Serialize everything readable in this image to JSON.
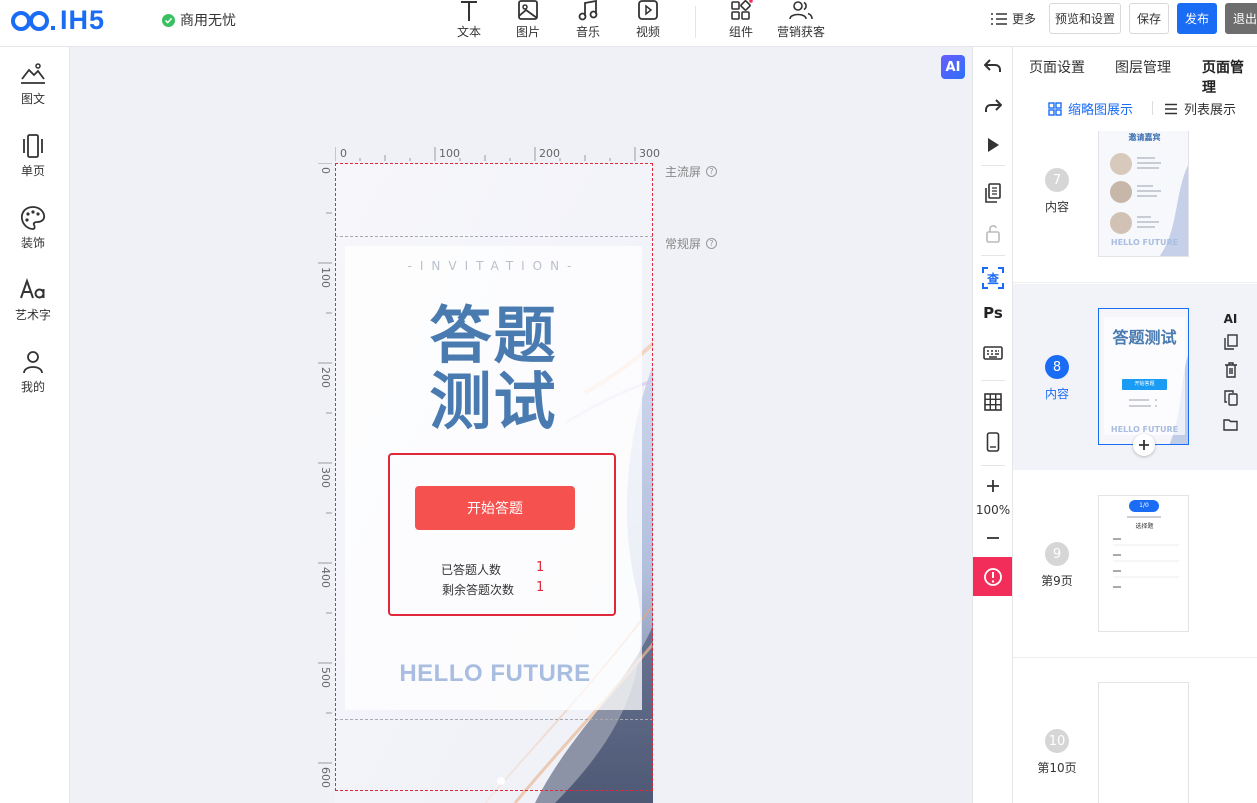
{
  "header": {
    "logo_text": "IH5",
    "commercial_label": "商用无忧",
    "tools": [
      {
        "label": "文本",
        "icon": "text-icon"
      },
      {
        "label": "图片",
        "icon": "image-icon"
      },
      {
        "label": "音乐",
        "icon": "music-icon"
      },
      {
        "label": "视频",
        "icon": "video-icon"
      },
      {
        "label": "组件",
        "icon": "component-icon"
      },
      {
        "label": "营销获客",
        "icon": "marketing-icon"
      }
    ],
    "more_label": "更多",
    "preview_label": "预览和设置",
    "save_label": "保存",
    "publish_label": "发布",
    "exit_label": "退出"
  },
  "sidebar": {
    "items": [
      {
        "label": "图文",
        "icon": "graphic-text-icon"
      },
      {
        "label": "单页",
        "icon": "single-page-icon"
      },
      {
        "label": "装饰",
        "icon": "palette-icon"
      },
      {
        "label": "艺术字",
        "icon": "art-text-icon"
      },
      {
        "label": "我的",
        "icon": "user-icon"
      }
    ]
  },
  "canvas": {
    "ai_label": "AI",
    "ruler_top": [
      "0",
      "100",
      "200",
      "300"
    ],
    "ruler_left": [
      "0",
      "100",
      "200",
      "300",
      "400",
      "500",
      "600"
    ],
    "main_screen_label": "主流屏",
    "normal_screen_label": "常规屏",
    "invitation_text": "-INVITATION-",
    "title_line1": "答题",
    "title_line2": "测试",
    "start_button": "开始答题",
    "answered_label": "已答题人数",
    "answered_value": "1",
    "remaining_label": "剩余答题次数",
    "remaining_value": "1",
    "hello_text": "HELLO FUTURE"
  },
  "vertical_toolbar": {
    "zoom_level": "100%",
    "ps_label": "Ps",
    "check_label": "查"
  },
  "right_panel": {
    "tabs": [
      "页面设置",
      "图层管理",
      "页面管理"
    ],
    "view_thumbnail": "缩略图展示",
    "view_list": "列表展示",
    "pages": [
      {
        "num": "7",
        "label": "内容"
      },
      {
        "num": "8",
        "label": "内容"
      },
      {
        "num": "9",
        "label": "第9页"
      },
      {
        "num": "10",
        "label": "第10页"
      }
    ],
    "ai_action": "AI",
    "thumb7_title": "邀请嘉宾",
    "thumb7_footer": "HELLO FUTURE",
    "thumb8_title": "答题测试",
    "thumb8_btn": "开始答题",
    "thumb8_footer": "HELLO FUTURE",
    "thumb9_badge": "1/0",
    "thumb9_title": "选择题"
  },
  "colors": {
    "brand": "#1a6cf5",
    "title_blue": "#4a7bb0",
    "start_button": "#f5524f",
    "selection": "#e0283a",
    "alert": "#f22d5a"
  }
}
